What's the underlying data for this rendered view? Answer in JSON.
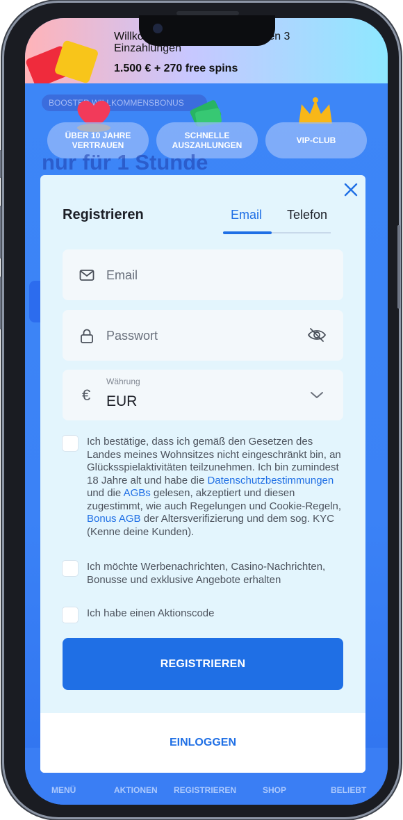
{
  "promo": {
    "line1": "Willkommensbonus auf die ersten 3",
    "line1b": "Einzahlungen",
    "line2": "1.500 € + 270 free spins"
  },
  "background": {
    "boost_label": "BOOSTER WILLKOMMENSBONUS",
    "headline": "nur für 1 Stunde",
    "features": [
      "ÜBER 10 JAHRE VERTRAUEN",
      "SCHNELLE AUSZAHLUNGEN",
      "VIP-CLUB"
    ]
  },
  "modal": {
    "title": "Registrieren",
    "tabs": [
      {
        "label": "Email",
        "active": true
      },
      {
        "label": "Telefon",
        "active": false
      }
    ],
    "email": {
      "placeholder": "Email",
      "icon": "mail-icon"
    },
    "password": {
      "placeholder": "Passwort",
      "icon": "lock-icon",
      "toggle_icon": "eye-off-icon"
    },
    "currency": {
      "label": "Währung",
      "value": "EUR",
      "symbol": "€"
    },
    "terms": {
      "part1": "Ich bestätige, dass ich gemäß den Gesetzen des Landes meines Wohnsitzes nicht eingeschränkt bin, an Glücksspielaktivitäten teilzunehmen. Ich bin zumindest 18 Jahre alt und habe die ",
      "link_privacy": "Datenschutzbestimmungen",
      "part2": " und die ",
      "link_agb": "AGBs",
      "part3": " gelesen, akzeptiert und diesen zugestimmt, wie auch Regelungen und Cookie-Regeln, ",
      "link_bonus": "Bonus AGB",
      "part4": " der Altersverifizierung und dem sog. KYC (Kenne deine Kunden)."
    },
    "marketing": "Ich möchte Werbenachrichten, Casino-Nachrichten, Bonusse und exklusive Angebote erhalten",
    "promo_code": "Ich habe einen Aktionscode",
    "submit": "REGISTRIEREN",
    "login": "EINLOGGEN"
  },
  "bottom_nav": [
    "MENÜ",
    "AKTIONEN",
    "REGISTRIEREN",
    "SHOP",
    "BELIEBT"
  ],
  "colors": {
    "accent": "#1f6fe5",
    "modal_bg": "#e3f5fd",
    "page_bg": "#3b82f6"
  }
}
